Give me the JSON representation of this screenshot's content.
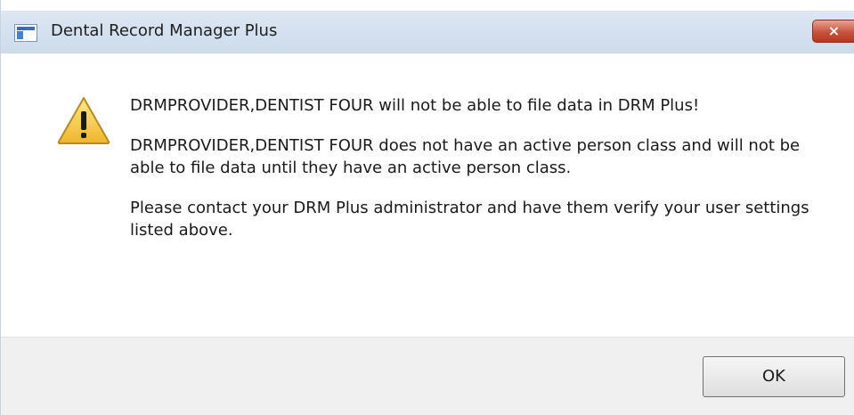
{
  "window": {
    "title": "Dental Record Manager Plus",
    "close_glyph": "×"
  },
  "dialog": {
    "icon": "warning-icon",
    "messages": [
      "DRMPROVIDER,DENTIST FOUR will not be able to file data in DRM Plus!",
      "DRMPROVIDER,DENTIST FOUR does not have an active person class and will not be able to file data until they have an active person class.",
      "Please contact your DRM Plus administrator and have them verify your user settings listed above."
    ]
  },
  "buttons": {
    "ok_label": "OK"
  },
  "colors": {
    "close_button": "#c7533d",
    "warning_fill": "#f5c542",
    "titlebar": "#d5e1ef"
  }
}
